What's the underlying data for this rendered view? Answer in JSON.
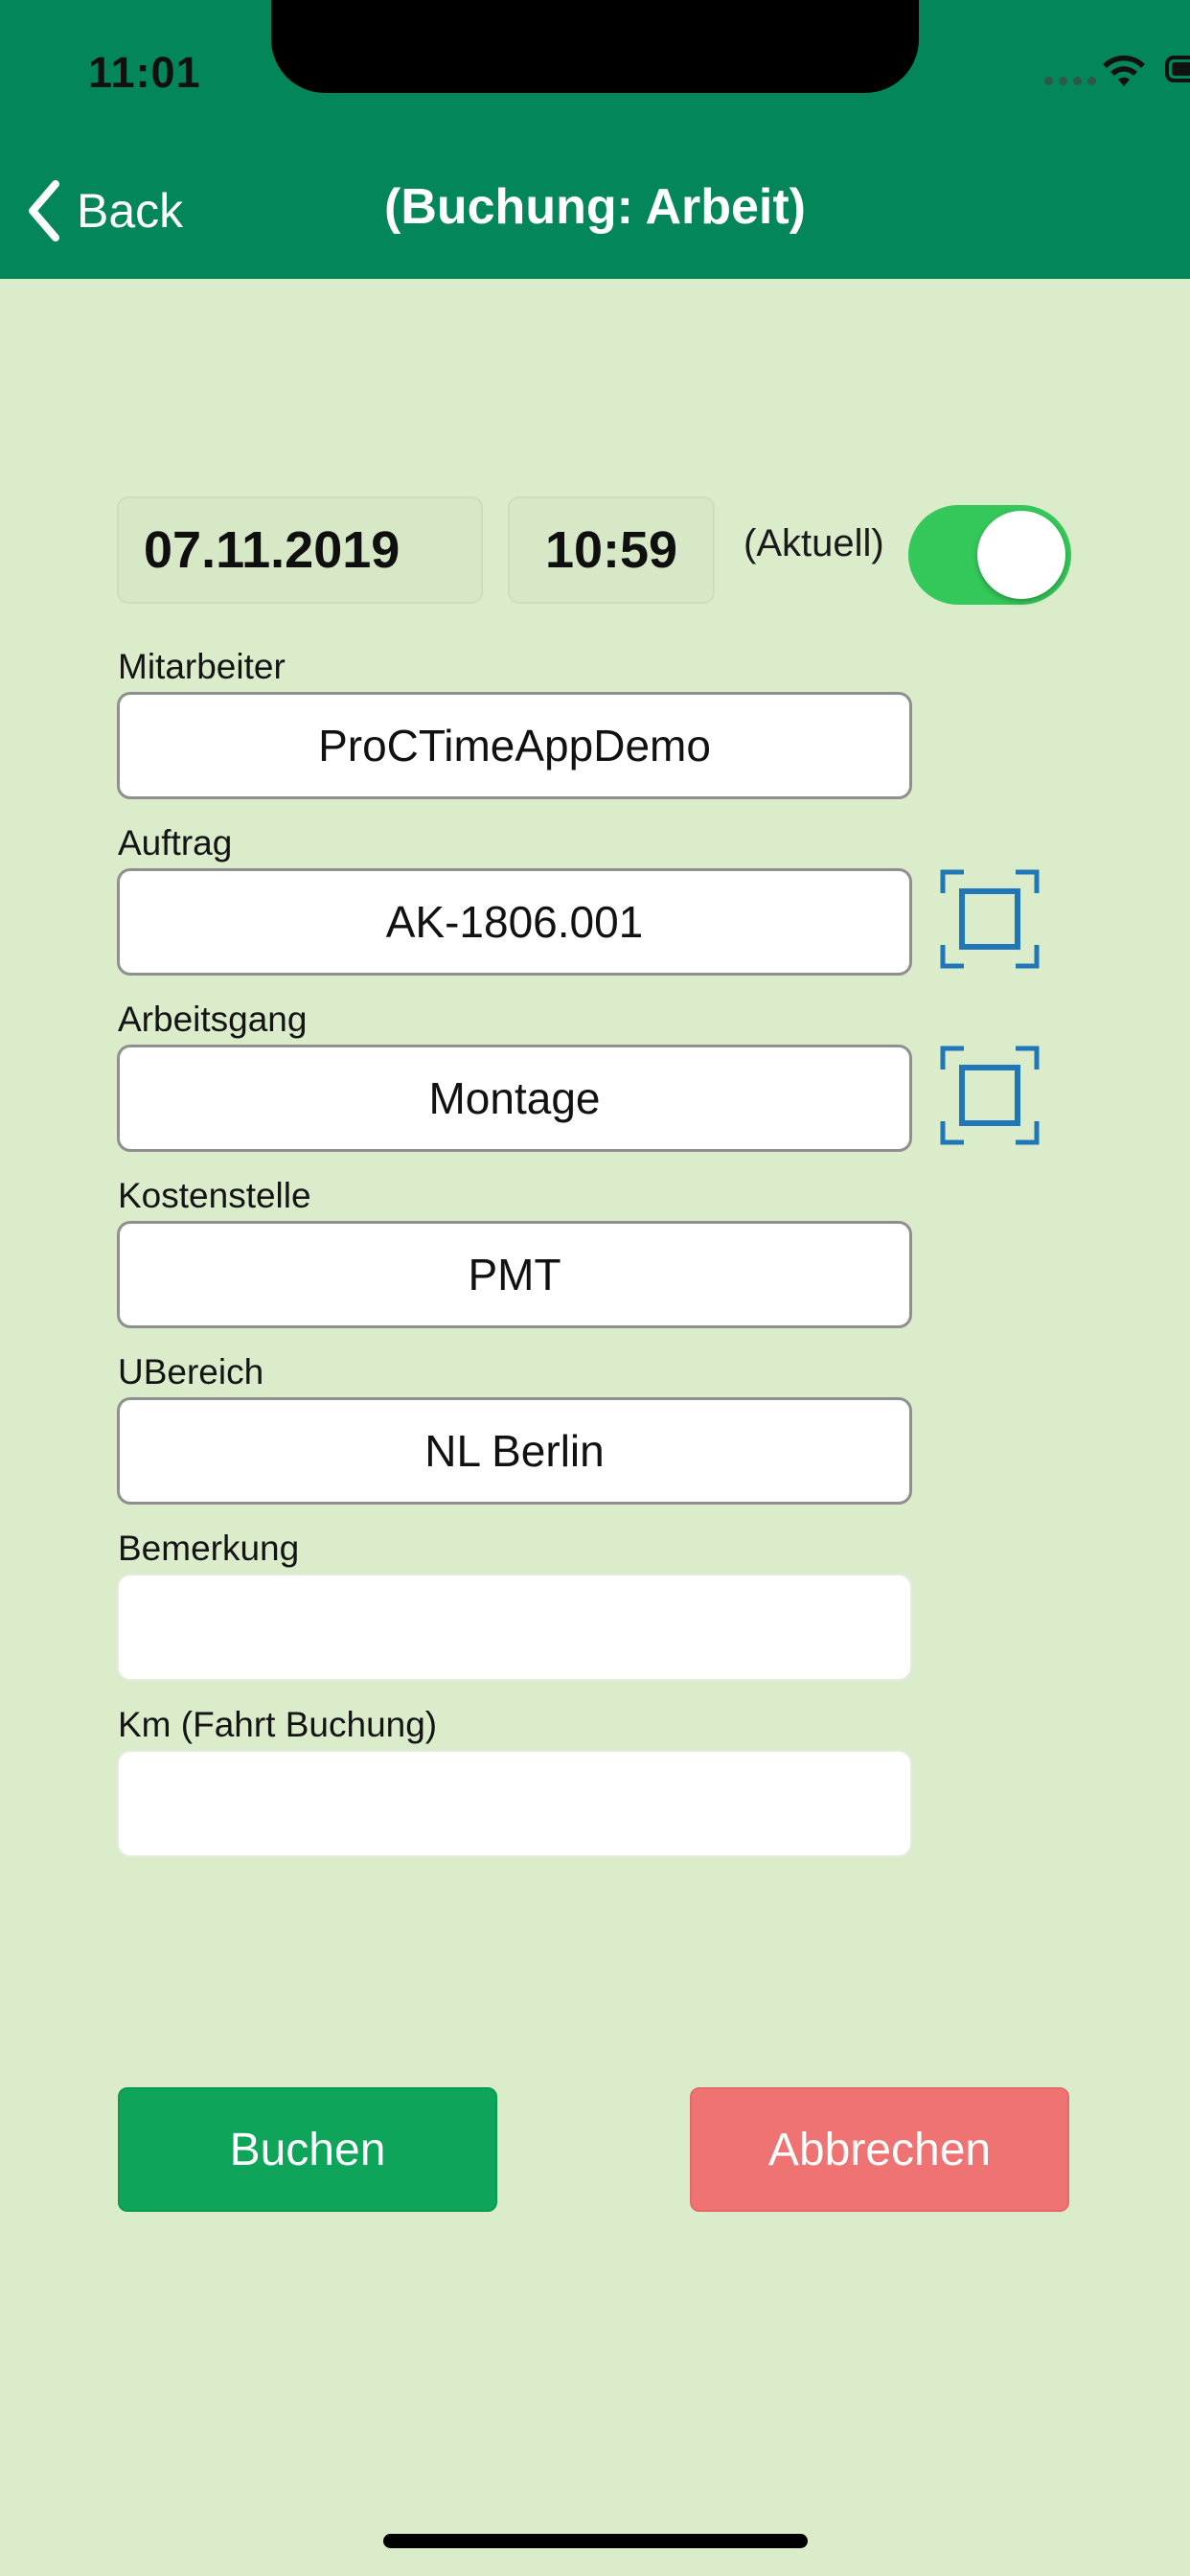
{
  "status_bar": {
    "time": "11:01"
  },
  "nav": {
    "back_label": "Back",
    "title": "(Buchung: Arbeit)"
  },
  "datetime": {
    "date": "07.11.2019",
    "time": "10:59",
    "aktuell_label": "(Aktuell)",
    "aktuell_on": true
  },
  "fields": {
    "mitarbeiter": {
      "label": "Mitarbeiter",
      "value": "ProCTimeAppDemo"
    },
    "auftrag": {
      "label": "Auftrag",
      "value": "AK-1806.001"
    },
    "arbeitsgang": {
      "label": "Arbeitsgang",
      "value": "Montage"
    },
    "kostenstelle": {
      "label": "Kostenstelle",
      "value": "PMT"
    },
    "ubereich": {
      "label": "UBereich",
      "value": "NL Berlin"
    },
    "bemerkung": {
      "label": "Bemerkung",
      "value": ""
    },
    "km": {
      "label": "Km (Fahrt Buchung)",
      "value": ""
    }
  },
  "buttons": {
    "book": "Buchen",
    "cancel": "Abbrechen"
  },
  "icons": {
    "back": "chevron-left-icon",
    "scan": "scan-frame-icon",
    "wifi": "wifi-icon",
    "battery": "battery-icon"
  },
  "colors": {
    "header": "#03865a",
    "background": "#daecca",
    "toggle": "#34c759",
    "book": "#0ea55a",
    "cancel": "#ee7372",
    "scan_icon": "#1f77b8"
  }
}
